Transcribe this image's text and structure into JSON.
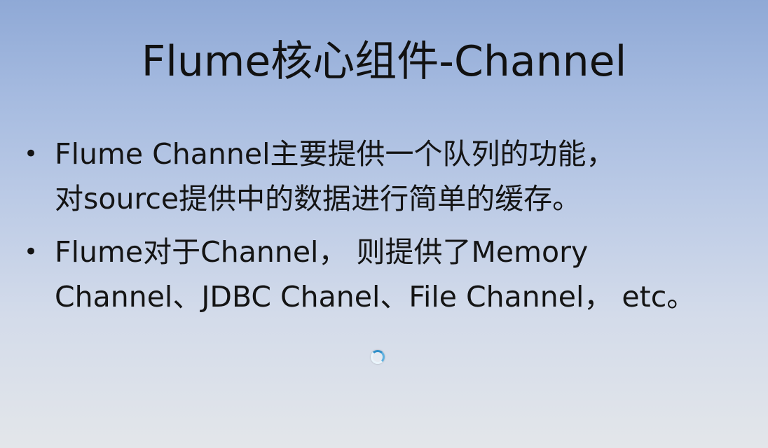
{
  "slide": {
    "title": "Flume核心组件-Channel",
    "bullets": [
      {
        "marker": "•",
        "lines": [
          "Flume Channel主要提供一个队列的功能，",
          "对source提供中的数据进行简单的缓存。"
        ]
      },
      {
        "marker": "•",
        "lines": [
          "Flume对于Channel， 则提供了Memory",
          "Channel、JDBC Chanel、File Channel， etc。"
        ]
      }
    ]
  },
  "colors": {
    "background_top": "#8fa9d6",
    "background_bottom": "#e3e6ea",
    "text": "#111111",
    "spinner_accent": "#2f8fc9"
  },
  "icons": {
    "spinner": "loading-spinner-icon"
  }
}
